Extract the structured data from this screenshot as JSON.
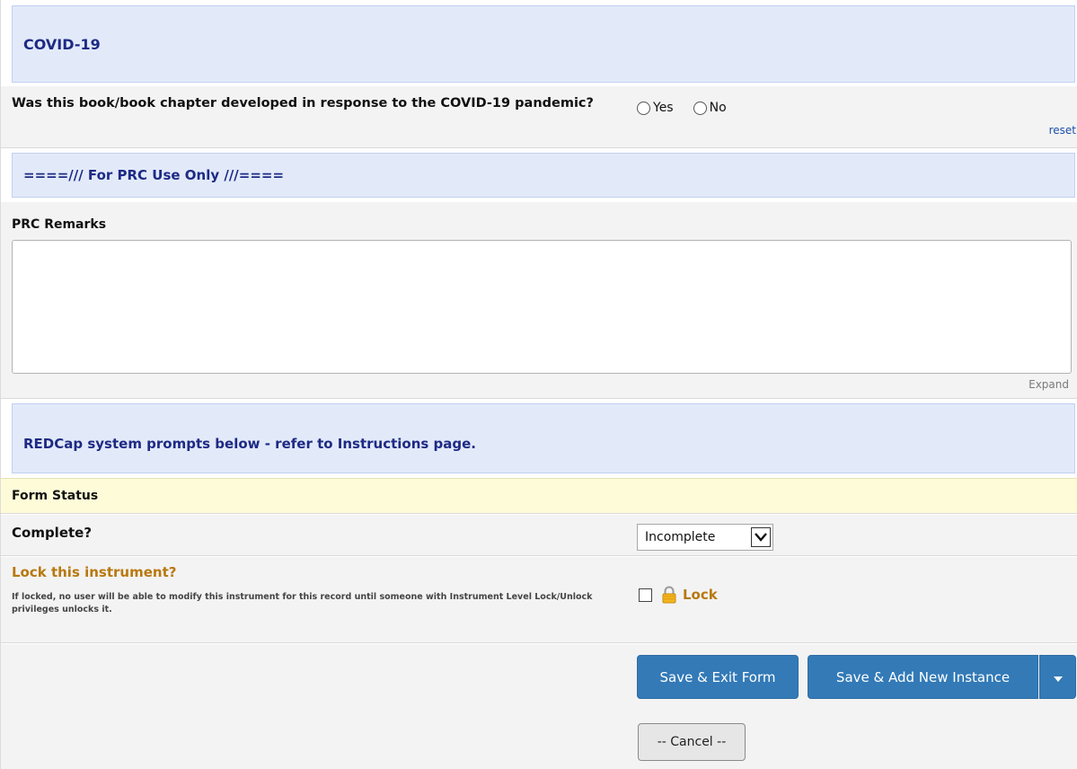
{
  "sections": {
    "covid_header": "COVID-19",
    "prc_header": "====/// For PRC Use Only ///====",
    "redcap_header": "REDCap system prompts below - refer to Instructions page."
  },
  "covid_question": {
    "label": "Was this book/book chapter developed in response to the COVID-19 pandemic?",
    "options": [
      "Yes",
      "No"
    ],
    "reset_label": "reset"
  },
  "prc_remarks": {
    "label": "PRC Remarks",
    "value": "",
    "expand_label": "Expand"
  },
  "form_status": {
    "header": "Form Status",
    "complete_label": "Complete?",
    "complete_value": "Incomplete"
  },
  "lock": {
    "title": "Lock this instrument?",
    "help": "If locked, no user will be able to modify this instrument for this record until someone with Instrument Level Lock/Unlock privileges unlocks it.",
    "checkbox_label": "Lock",
    "checked": false
  },
  "buttons": {
    "save_exit": "Save & Exit Form",
    "save_add": "Save & Add New Instance",
    "cancel": "-- Cancel --"
  },
  "colors": {
    "header_bg": "#e2eafa",
    "header_text": "#1e2a84",
    "primary_button": "#337ab7",
    "lock_text": "#b8780f",
    "status_bg": "#fefcd8"
  }
}
